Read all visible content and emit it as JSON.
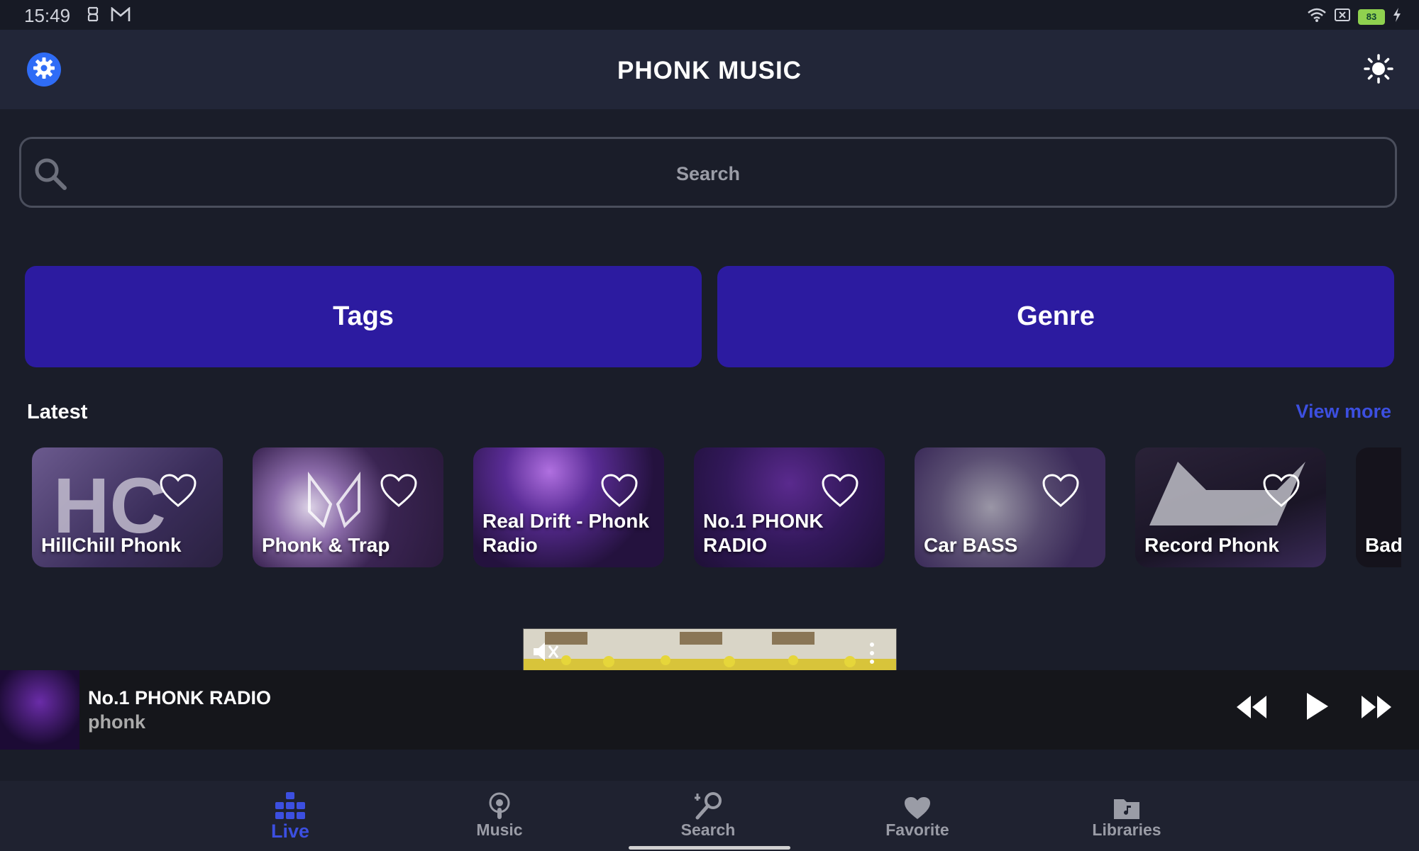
{
  "status_bar": {
    "time": "15:49",
    "battery": "83"
  },
  "app_bar": {
    "title": "PHONK MUSIC",
    "settings_icon": "gear-icon",
    "theme_icon": "sun-icon"
  },
  "search": {
    "placeholder": "Search"
  },
  "buttons": {
    "tags": "Tags",
    "genre": "Genre"
  },
  "latest": {
    "title": "Latest",
    "view_more": "View more",
    "stations": [
      {
        "name": "HillChill Phonk"
      },
      {
        "name": "Phonk & Trap"
      },
      {
        "name": "Real Drift - Phonk Radio"
      },
      {
        "name": "No.1 PHONK RADIO"
      },
      {
        "name": "Car BASS"
      },
      {
        "name": "Record Phonk"
      },
      {
        "name": "Bad"
      }
    ]
  },
  "player": {
    "title": "No.1 PHONK RADIO",
    "subtitle": "phonk"
  },
  "bottom_nav": {
    "items": [
      {
        "label": "Live"
      },
      {
        "label": "Music"
      },
      {
        "label": "Search"
      },
      {
        "label": "Favorite"
      },
      {
        "label": "Libraries"
      }
    ]
  },
  "colors": {
    "accent": "#3c4fe0",
    "button_bg": "#2c1ba0",
    "background": "#1a1d29"
  }
}
